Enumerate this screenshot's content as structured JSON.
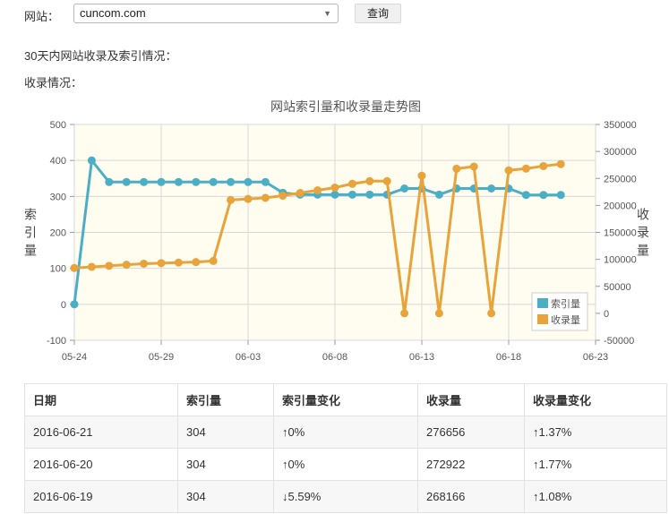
{
  "toolbar": {
    "site_label": "网站：",
    "site_value": "cuncom.com",
    "query_label": "查询"
  },
  "sections": {
    "summary_label": "30天内网站收录及索引情况：",
    "records_label": "收录情况："
  },
  "chart_data": {
    "type": "line",
    "title": "网站索引量和收录量走势图",
    "ylabel": "索引量",
    "y2label": "收录量",
    "x_ticks": [
      "05-24",
      "05-29",
      "06-03",
      "06-08",
      "06-13",
      "06-18",
      "06-23"
    ],
    "y_ticks": [
      "-100",
      "0",
      "100",
      "200",
      "300",
      "400",
      "500"
    ],
    "y2_ticks": [
      "-50000",
      "0",
      "50000",
      "100000",
      "150000",
      "200000",
      "250000",
      "300000",
      "350000"
    ],
    "ylim": [
      -100,
      500
    ],
    "y2lim": [
      -50000,
      350000
    ],
    "grid": true,
    "legend_position": "bottom-right",
    "x": [
      "05-24",
      "05-25",
      "05-26",
      "05-27",
      "05-28",
      "05-29",
      "05-30",
      "05-31",
      "06-01",
      "06-02",
      "06-03",
      "06-04",
      "06-05",
      "06-06",
      "06-07",
      "06-08",
      "06-09",
      "06-10",
      "06-11",
      "06-12",
      "06-13",
      "06-14",
      "06-15",
      "06-16",
      "06-17",
      "06-18",
      "06-19",
      "06-20",
      "06-21"
    ],
    "series": [
      {
        "name": "索引量",
        "axis": "left",
        "color": "#4aaec4",
        "values": [
          0,
          400,
          340,
          340,
          340,
          340,
          340,
          340,
          340,
          340,
          340,
          340,
          310,
          305,
          305,
          305,
          305,
          305,
          305,
          322,
          322,
          305,
          322,
          322,
          322,
          322,
          304,
          304,
          304
        ]
      },
      {
        "name": "收录量",
        "axis": "right",
        "color": "#e8a33a",
        "values": [
          84000,
          86000,
          88000,
          90000,
          92000,
          93000,
          94000,
          95000,
          97000,
          210000,
          212000,
          214000,
          218000,
          223000,
          228000,
          233000,
          240000,
          245000,
          245000,
          0,
          255000,
          0,
          268000,
          272000,
          0,
          265000,
          268166,
          272922,
          276656
        ]
      }
    ]
  },
  "table": {
    "headers": [
      "日期",
      "索引量",
      "索引量变化",
      "收录量",
      "收录量变化"
    ],
    "rows": [
      {
        "date": "2016-06-21",
        "index": "304",
        "index_change": "↑0%",
        "index_dir": "up",
        "records": "276656",
        "records_change": "↑1.37%",
        "records_dir": "up"
      },
      {
        "date": "2016-06-20",
        "index": "304",
        "index_change": "↑0%",
        "index_dir": "up",
        "records": "272922",
        "records_change": "↑1.77%",
        "records_dir": "up"
      },
      {
        "date": "2016-06-19",
        "index": "304",
        "index_change": "↓5.59%",
        "index_dir": "down",
        "records": "268166",
        "records_change": "↑1.08%",
        "records_dir": "up"
      }
    ]
  }
}
